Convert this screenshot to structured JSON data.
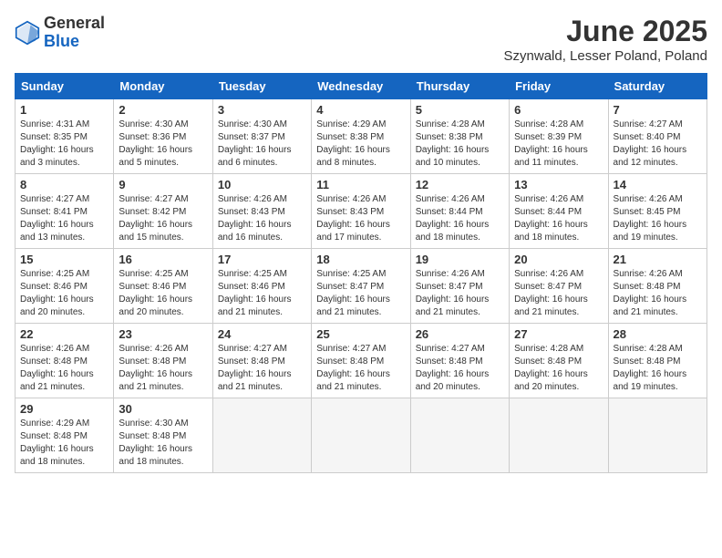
{
  "header": {
    "logo_line1": "General",
    "logo_line2": "Blue",
    "month": "June 2025",
    "location": "Szynwald, Lesser Poland, Poland"
  },
  "weekdays": [
    "Sunday",
    "Monday",
    "Tuesday",
    "Wednesday",
    "Thursday",
    "Friday",
    "Saturday"
  ],
  "weeks": [
    [
      {
        "day": "1",
        "info": "Sunrise: 4:31 AM\nSunset: 8:35 PM\nDaylight: 16 hours\nand 3 minutes."
      },
      {
        "day": "2",
        "info": "Sunrise: 4:30 AM\nSunset: 8:36 PM\nDaylight: 16 hours\nand 5 minutes."
      },
      {
        "day": "3",
        "info": "Sunrise: 4:30 AM\nSunset: 8:37 PM\nDaylight: 16 hours\nand 6 minutes."
      },
      {
        "day": "4",
        "info": "Sunrise: 4:29 AM\nSunset: 8:38 PM\nDaylight: 16 hours\nand 8 minutes."
      },
      {
        "day": "5",
        "info": "Sunrise: 4:28 AM\nSunset: 8:38 PM\nDaylight: 16 hours\nand 10 minutes."
      },
      {
        "day": "6",
        "info": "Sunrise: 4:28 AM\nSunset: 8:39 PM\nDaylight: 16 hours\nand 11 minutes."
      },
      {
        "day": "7",
        "info": "Sunrise: 4:27 AM\nSunset: 8:40 PM\nDaylight: 16 hours\nand 12 minutes."
      }
    ],
    [
      {
        "day": "8",
        "info": "Sunrise: 4:27 AM\nSunset: 8:41 PM\nDaylight: 16 hours\nand 13 minutes."
      },
      {
        "day": "9",
        "info": "Sunrise: 4:27 AM\nSunset: 8:42 PM\nDaylight: 16 hours\nand 15 minutes."
      },
      {
        "day": "10",
        "info": "Sunrise: 4:26 AM\nSunset: 8:43 PM\nDaylight: 16 hours\nand 16 minutes."
      },
      {
        "day": "11",
        "info": "Sunrise: 4:26 AM\nSunset: 8:43 PM\nDaylight: 16 hours\nand 17 minutes."
      },
      {
        "day": "12",
        "info": "Sunrise: 4:26 AM\nSunset: 8:44 PM\nDaylight: 16 hours\nand 18 minutes."
      },
      {
        "day": "13",
        "info": "Sunrise: 4:26 AM\nSunset: 8:44 PM\nDaylight: 16 hours\nand 18 minutes."
      },
      {
        "day": "14",
        "info": "Sunrise: 4:26 AM\nSunset: 8:45 PM\nDaylight: 16 hours\nand 19 minutes."
      }
    ],
    [
      {
        "day": "15",
        "info": "Sunrise: 4:25 AM\nSunset: 8:46 PM\nDaylight: 16 hours\nand 20 minutes."
      },
      {
        "day": "16",
        "info": "Sunrise: 4:25 AM\nSunset: 8:46 PM\nDaylight: 16 hours\nand 20 minutes."
      },
      {
        "day": "17",
        "info": "Sunrise: 4:25 AM\nSunset: 8:46 PM\nDaylight: 16 hours\nand 21 minutes."
      },
      {
        "day": "18",
        "info": "Sunrise: 4:25 AM\nSunset: 8:47 PM\nDaylight: 16 hours\nand 21 minutes."
      },
      {
        "day": "19",
        "info": "Sunrise: 4:26 AM\nSunset: 8:47 PM\nDaylight: 16 hours\nand 21 minutes."
      },
      {
        "day": "20",
        "info": "Sunrise: 4:26 AM\nSunset: 8:47 PM\nDaylight: 16 hours\nand 21 minutes."
      },
      {
        "day": "21",
        "info": "Sunrise: 4:26 AM\nSunset: 8:48 PM\nDaylight: 16 hours\nand 21 minutes."
      }
    ],
    [
      {
        "day": "22",
        "info": "Sunrise: 4:26 AM\nSunset: 8:48 PM\nDaylight: 16 hours\nand 21 minutes."
      },
      {
        "day": "23",
        "info": "Sunrise: 4:26 AM\nSunset: 8:48 PM\nDaylight: 16 hours\nand 21 minutes."
      },
      {
        "day": "24",
        "info": "Sunrise: 4:27 AM\nSunset: 8:48 PM\nDaylight: 16 hours\nand 21 minutes."
      },
      {
        "day": "25",
        "info": "Sunrise: 4:27 AM\nSunset: 8:48 PM\nDaylight: 16 hours\nand 21 minutes."
      },
      {
        "day": "26",
        "info": "Sunrise: 4:27 AM\nSunset: 8:48 PM\nDaylight: 16 hours\nand 20 minutes."
      },
      {
        "day": "27",
        "info": "Sunrise: 4:28 AM\nSunset: 8:48 PM\nDaylight: 16 hours\nand 20 minutes."
      },
      {
        "day": "28",
        "info": "Sunrise: 4:28 AM\nSunset: 8:48 PM\nDaylight: 16 hours\nand 19 minutes."
      }
    ],
    [
      {
        "day": "29",
        "info": "Sunrise: 4:29 AM\nSunset: 8:48 PM\nDaylight: 16 hours\nand 18 minutes."
      },
      {
        "day": "30",
        "info": "Sunrise: 4:30 AM\nSunset: 8:48 PM\nDaylight: 16 hours\nand 18 minutes."
      },
      null,
      null,
      null,
      null,
      null
    ]
  ]
}
